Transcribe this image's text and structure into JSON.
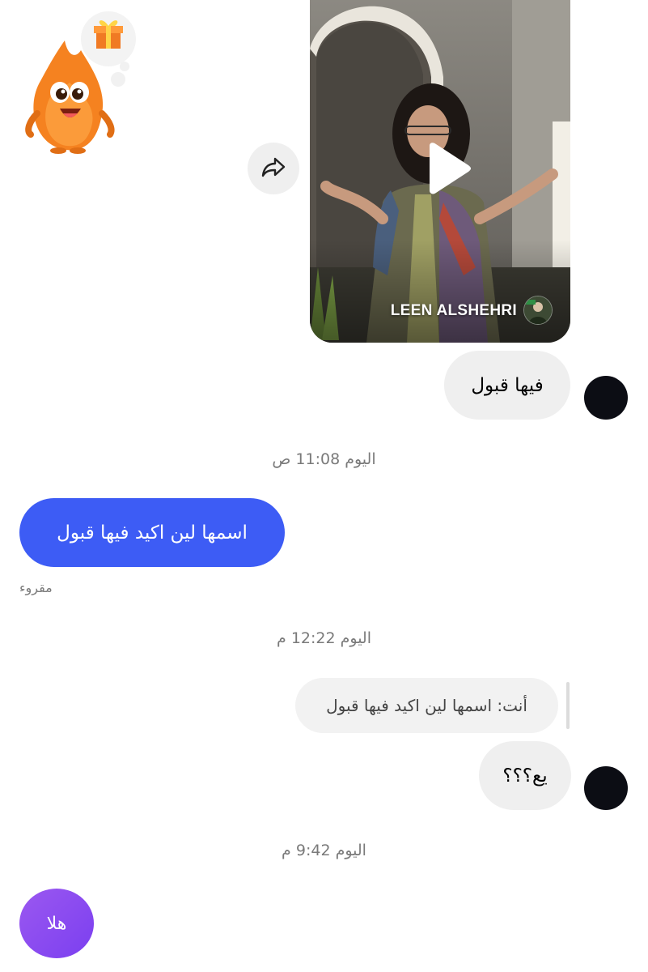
{
  "video": {
    "author": "LEEN ALSHEHRI"
  },
  "messages": {
    "incoming_1": "فيها قبول",
    "timestamp_1": "اليوم 11:08 ص",
    "outgoing_1": "اسمها لين اكيد فيها قبول",
    "read_status": "مقروء",
    "timestamp_2": "اليوم 12:22 م",
    "reply_quote": "أنت: اسمها لين اكيد فيها قبول",
    "incoming_2": "يع؟؟؟",
    "timestamp_3": "اليوم 9:42 م"
  },
  "quick_reply": {
    "label": "هلا"
  },
  "colors": {
    "outgoing_bubble": "#3d5cf5",
    "incoming_bubble": "#efefef",
    "quick_reply": "#8a4ef2"
  },
  "icons": {
    "share": "share-arrow-icon",
    "play": "play-icon",
    "mascot": "flame-mascot-gift-sticker"
  }
}
